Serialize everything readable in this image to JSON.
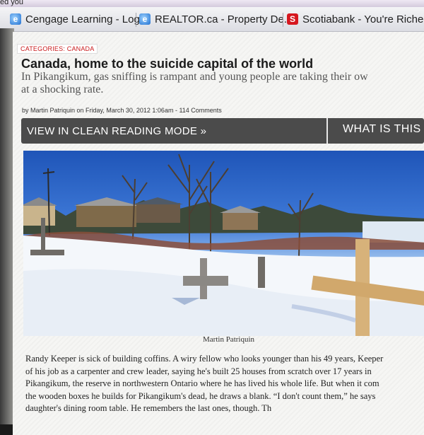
{
  "browser": {
    "partial_tab_text": "ed you",
    "favorites": [
      {
        "label": "Cengage Learning - Login",
        "icon": "ie-page-icon"
      },
      {
        "label": "REALTOR.ca - Property De...",
        "icon": "ie-page-icon"
      },
      {
        "label": "Scotiabank - You're Riche",
        "icon": "scotiabank-icon"
      }
    ]
  },
  "article": {
    "category_label": "CATEGORIES: CANADA",
    "title": "Canada, home to the suicide capital of the world",
    "subtitle_line1": "In Pikangikum, gas sniffing is rampant and young people are taking their ow",
    "subtitle_line2": "at a shocking rate.",
    "byline": "by Martin Patriquin on Friday, March 30, 2012 1:06am - 114 Comments",
    "reading_mode_label": "VIEW IN CLEAN READING MODE »",
    "what_is_this_label": "WHAT IS THIS",
    "photo_caption": "Martin Patriquin",
    "body_lines": [
      "Randy Keeper is sick of building coffins. A wiry fellow who looks younger than his 49 years, Keeper",
      "of his job as a carpenter and crew leader, saying he's built 25 houses from scratch over 17 years in",
      "Pikangikum, the reserve in northwestern Ontario where he has lived his whole life. But when it com",
      "the wooden boxes he builds for Pikangikum's dead, he draws a blank. “I don't count them,” he says",
      "daughter's dining room table. He remembers the last ones, though. Th"
    ]
  }
}
